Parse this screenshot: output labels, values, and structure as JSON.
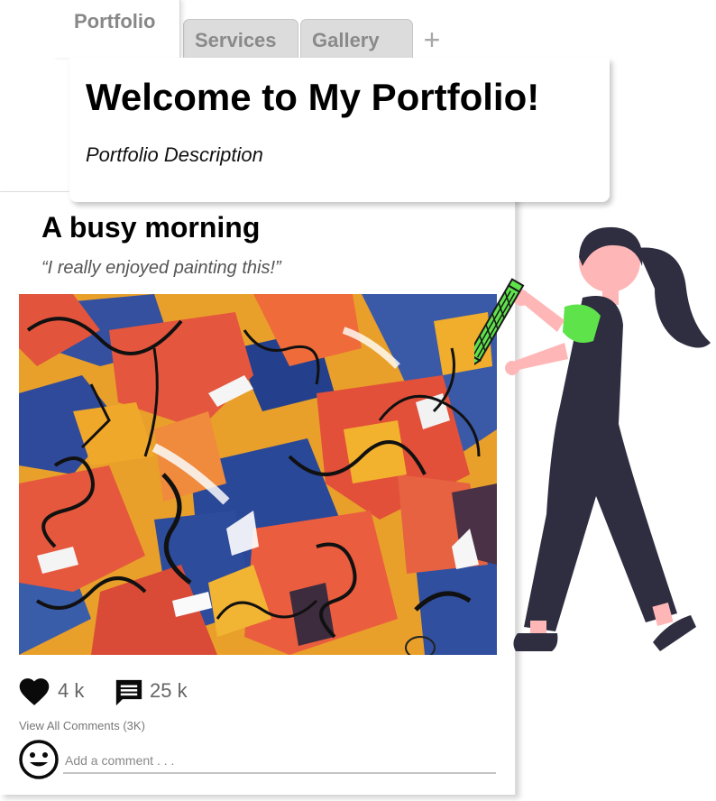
{
  "tabs": {
    "active": "Portfolio",
    "items": [
      "Services",
      "Gallery"
    ],
    "add_symbol": "+"
  },
  "header": {
    "title": "Welcome to My Portfolio!",
    "description": "Portfolio Description"
  },
  "post": {
    "title": "A busy morning",
    "caption": "“I really enjoyed painting this!”",
    "likes": "4 k",
    "comments": "25 k",
    "view_comments": "View All Comments (3K)",
    "comment_placeholder": "Add a comment . . .",
    "icons": {
      "like": "heart-icon",
      "comment": "comment-icon",
      "avatar": "smiley-face-icon"
    }
  },
  "colors": {
    "tab_active_text": "#888888",
    "tab_inactive_bg": "#dcdcdc",
    "pencil_green": "#5ee34b",
    "figure_dark": "#2f2e41",
    "skin": "#ffb6b6"
  }
}
